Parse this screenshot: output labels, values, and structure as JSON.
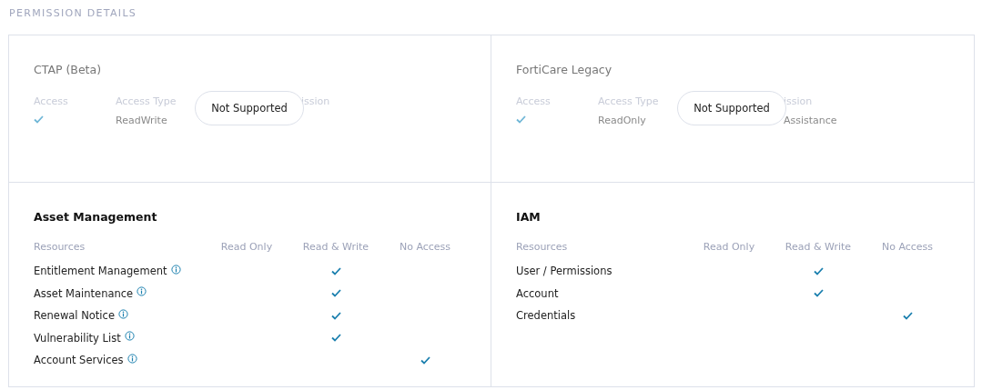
{
  "section_title": "PERMISSION DETAILS",
  "legacy_cards": [
    {
      "title": "CTAP (Beta)",
      "disabled": true,
      "headers": [
        "Access",
        "Access Type",
        "ission"
      ],
      "access": true,
      "access_type": "ReadWrite",
      "overlay": "Not Supported"
    },
    {
      "title": "FortiCare Legacy",
      "disabled": true,
      "headers": [
        "Access",
        "Access Type",
        "ission"
      ],
      "access": true,
      "access_type": "ReadOnly",
      "permission": "Assistance",
      "overlay": "Not Supported"
    }
  ],
  "resource_cards": [
    {
      "title": "Asset Management",
      "headers": [
        "Resources",
        "Read Only",
        "Read & Write",
        "No Access"
      ],
      "rows": [
        {
          "name": "Entitlement Management",
          "info": true,
          "read_only": false,
          "read_write": true,
          "no_access": false
        },
        {
          "name": "Asset Maintenance",
          "info": true,
          "read_only": false,
          "read_write": true,
          "no_access": false
        },
        {
          "name": "Renewal Notice",
          "info": true,
          "read_only": false,
          "read_write": true,
          "no_access": false
        },
        {
          "name": "Vulnerability List",
          "info": true,
          "read_only": false,
          "read_write": true,
          "no_access": false
        },
        {
          "name": "Account Services",
          "info": true,
          "read_only": false,
          "read_write": false,
          "no_access": true
        }
      ]
    },
    {
      "title": "IAM",
      "headers": [
        "Resources",
        "Read Only",
        "Read & Write",
        "No Access"
      ],
      "rows": [
        {
          "name": "User / Permissions",
          "info": false,
          "read_only": false,
          "read_write": true,
          "no_access": false
        },
        {
          "name": "Account",
          "info": false,
          "read_only": false,
          "read_write": true,
          "no_access": false
        },
        {
          "name": "Credentials",
          "info": false,
          "read_only": false,
          "read_write": false,
          "no_access": true
        }
      ]
    }
  ]
}
